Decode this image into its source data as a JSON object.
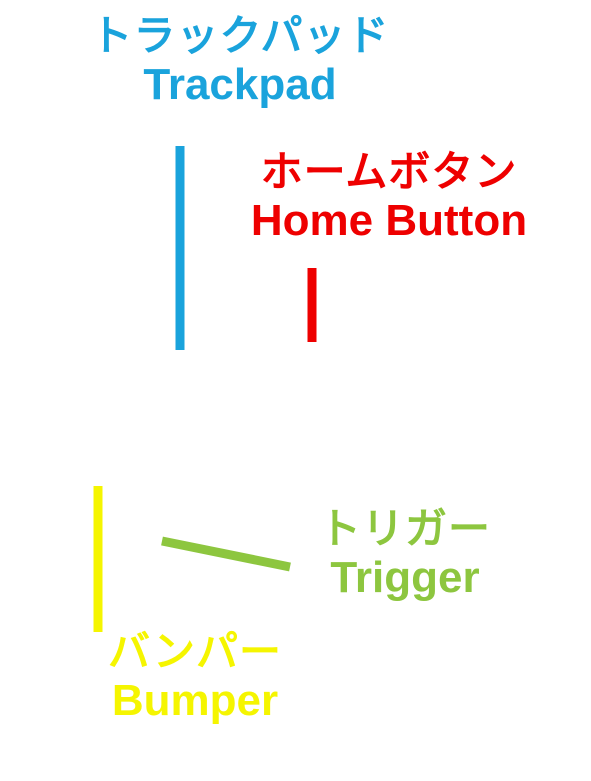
{
  "labels": {
    "trackpad": {
      "jp": "トラックパッド",
      "en": "Trackpad"
    },
    "home_button": {
      "jp": "ホームボタン",
      "en": "Home Button"
    },
    "trigger": {
      "jp": "トリガー",
      "en": "Trigger"
    },
    "bumper": {
      "jp": "バンパー",
      "en": "Bumper"
    }
  },
  "colors": {
    "trackpad": "#1aa3dc",
    "home_button": "#ee0000",
    "trigger": "#8dc63f",
    "bumper": "#f5f500",
    "background": "#ffffff"
  }
}
